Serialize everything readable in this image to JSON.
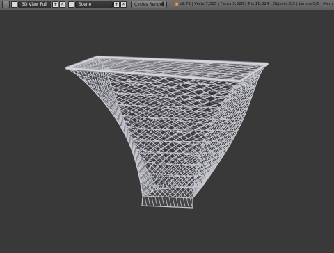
{
  "header": {
    "screen_layout": "3D View Full",
    "scene": "Scene",
    "render_engine": "Cycles Render",
    "stats": "v2.79 | Verts:7,315 | Faces:9,328 | Tris:18,624 | Objects:0/5 | Lamps:0/0 | Mem:56.30M"
  },
  "icons": {
    "editor_type": "info-icon",
    "layout_browse": "layout-icon",
    "layout_add": "plus-icon",
    "layout_remove": "close-icon",
    "scene_browse": "scene-icon",
    "scene_add": "plus-icon",
    "scene_remove": "close-icon",
    "engine_dropdown": "chevron-updown-icon",
    "blender": "blender-logo-icon"
  },
  "colors": {
    "viewport_background": "#393939",
    "header_background": "#6a6a6a",
    "mesh_wire": "#c8c8d0",
    "mesh_shadow": "#6a6a74"
  }
}
